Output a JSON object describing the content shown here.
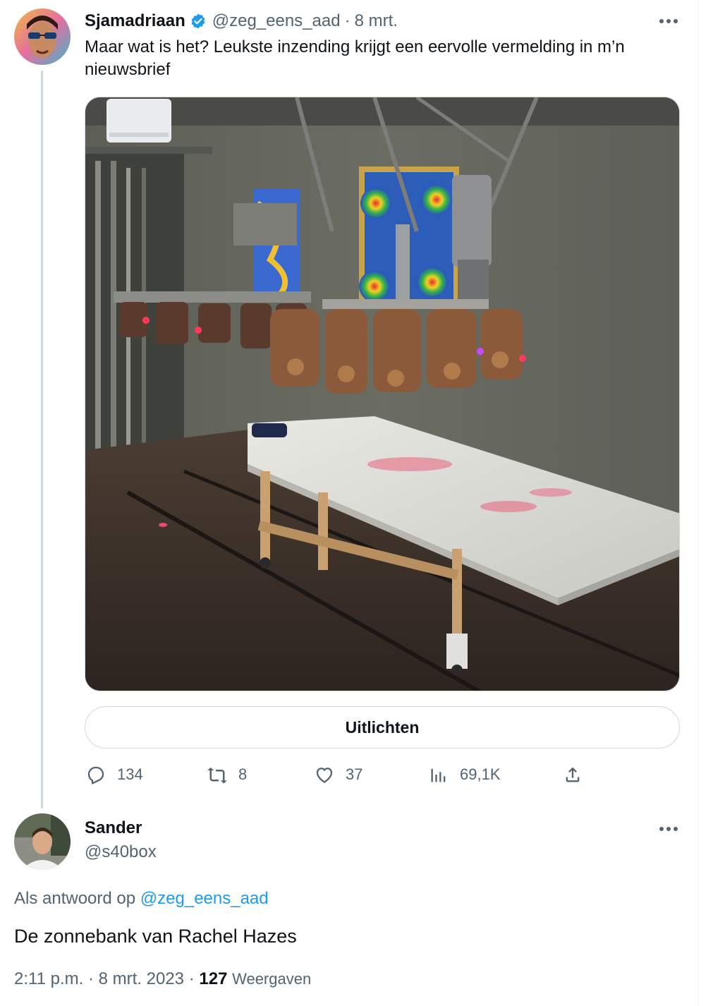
{
  "tweet": {
    "author_name": "Sjamadriaan",
    "handle": "@zeg_eens_aad",
    "separator": "·",
    "date": "8 mrt.",
    "text_line1": "Maar wat is het? Leukste inzending krijgt een eervolle vermelding in m’n",
    "text_line2": "nieuwsbrief",
    "translate_label": "Uitlichten",
    "actions": {
      "replies": "134",
      "retweets": "8",
      "likes": "37",
      "views": "69,1K"
    }
  },
  "reply": {
    "author_name": "Sander",
    "handle": "@s40box",
    "context_prefix": "Als antwoord op",
    "context_mention": "@zeg_eens_aad",
    "text": "De zonnebank van Rachel Hazes",
    "time": "2:11 p.m.",
    "separator": "·",
    "date": "8 mrt. 2023",
    "separator2": "·",
    "views_count": "127",
    "views_label": "Weergaven"
  },
  "icons": [
    "more-icon",
    "verified-badge-icon",
    "reply-icon",
    "retweet-icon",
    "like-icon",
    "views-icon",
    "share-icon"
  ],
  "colors": {
    "accent": "#1d9bf0",
    "muted": "#536471",
    "text": "#0f1419",
    "border": "#cfd9de"
  }
}
